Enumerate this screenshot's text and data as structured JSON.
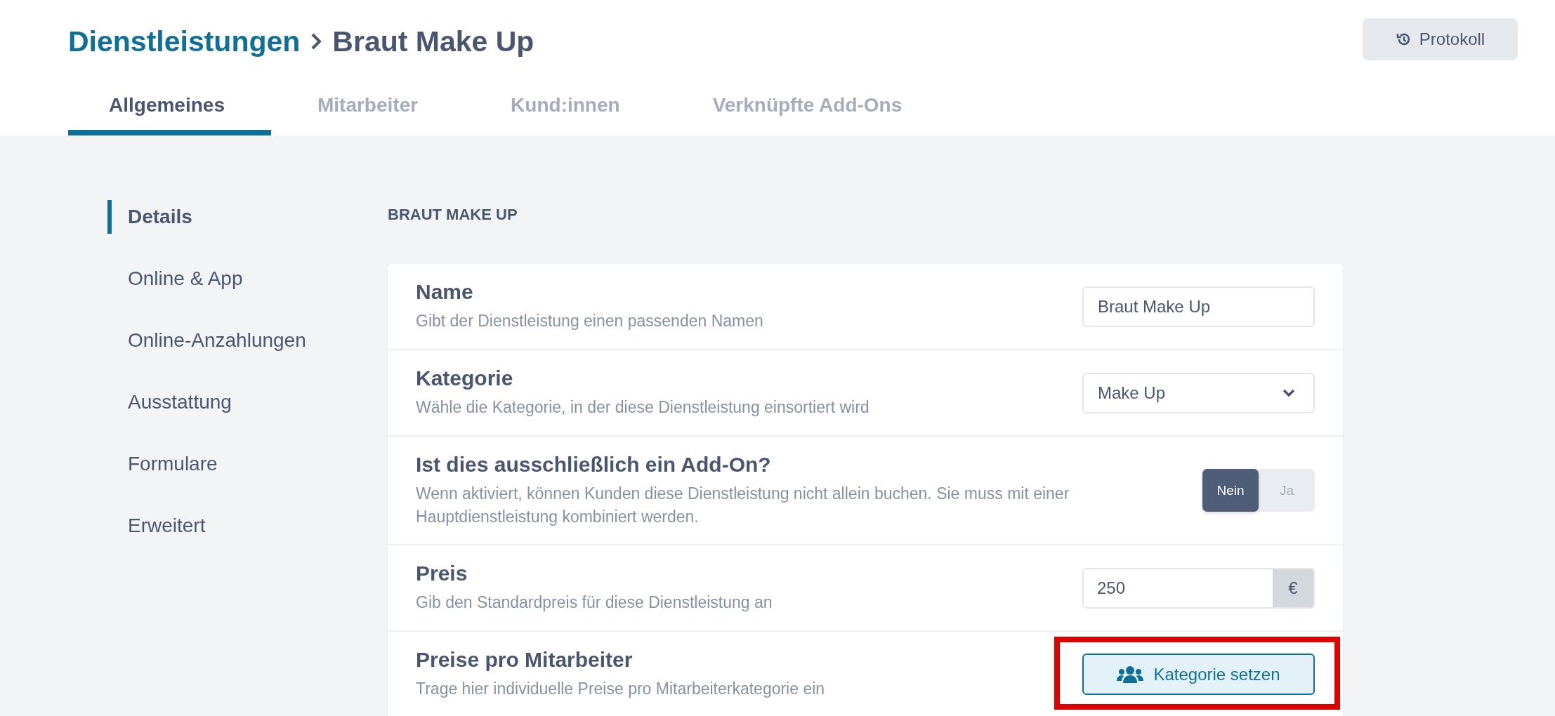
{
  "breadcrumb": {
    "parent": "Dienstleistungen",
    "current": "Braut Make Up"
  },
  "history_button": {
    "label": "Protokoll"
  },
  "tabs": [
    {
      "label": "Allgemeines",
      "selected": true
    },
    {
      "label": "Mitarbeiter",
      "selected": false
    },
    {
      "label": "Kund:innen",
      "selected": false
    },
    {
      "label": "Verknüpfte Add-Ons",
      "selected": false
    }
  ],
  "sidebar": {
    "items": [
      {
        "label": "Details",
        "selected": true
      },
      {
        "label": "Online & App",
        "selected": false
      },
      {
        "label": "Online-Anzahlungen",
        "selected": false
      },
      {
        "label": "Ausstattung",
        "selected": false
      },
      {
        "label": "Formulare",
        "selected": false
      },
      {
        "label": "Erweitert",
        "selected": false
      }
    ]
  },
  "section_title": "BRAUT MAKE UP",
  "settings": [
    {
      "kind": "text",
      "title": "Name",
      "description": "Gibt der Dienstleistung einen passenden Namen",
      "value": "Braut Make Up",
      "highlighted": false
    },
    {
      "kind": "select",
      "title": "Kategorie",
      "description": "Wähle die Kategorie, in der diese Dienstleistung einsortiert wird",
      "value": "Make Up",
      "highlighted": false
    },
    {
      "kind": "toggle",
      "title": "Ist dies ausschließlich ein Add-On?",
      "description": "Wenn aktiviert, können Kunden diese Dienstleistung nicht allein buchen. Sie muss mit einer Hauptdienstleistung kombiniert werden.",
      "options": [
        {
          "label": "Nein",
          "selected": true
        },
        {
          "label": "Ja",
          "selected": false
        }
      ],
      "highlighted": false
    },
    {
      "kind": "currency",
      "title": "Preis",
      "description": "Gib den Standardpreis für diese Dienstleistung an",
      "value": "250",
      "unit": "€",
      "highlighted": false
    },
    {
      "kind": "button",
      "title": "Preise pro Mitarbeiter",
      "description": "Trage hier individuelle Preise pro Mitarbeiterkategorie ein",
      "button_label": "Kategorie setzen",
      "highlighted": true
    }
  ]
}
